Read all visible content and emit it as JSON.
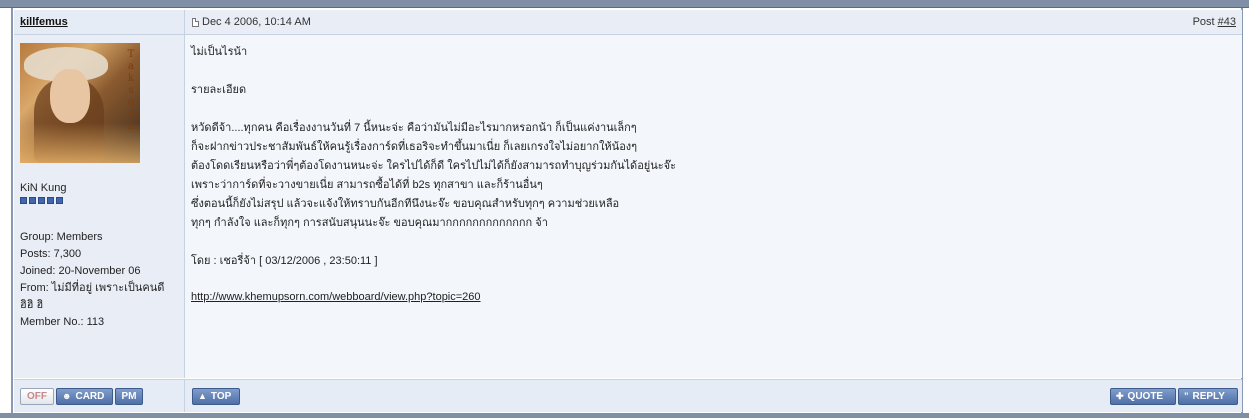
{
  "post": {
    "author": "killfemus",
    "date": "Dec 4 2006, 10:14 AM",
    "post_label": "Post ",
    "post_number": "#43"
  },
  "author_panel": {
    "avatar_letters": [
      "T",
      "a",
      "k",
      "s",
      "o",
      "r",
      "n"
    ],
    "title": "KiN Kung",
    "pip_count": 5,
    "group": "Group: Members",
    "posts": "Posts: 7,300",
    "joined": "Joined: 20-November 06",
    "from": "From: ไม่มีที่อยู่ เพราะเป็นคนดี ฮิฮิ ฮิ",
    "member_no": "Member No.: 113"
  },
  "body": {
    "lines": [
      "ไม่เป็นไรน้า",
      "",
      "รายละเอียด",
      "",
      "หวัดดีจ้า....ทุกคน คือเรื่องงานวันที่ 7 นี้หนะจ่ะ คือว่ามันไม่มีอะไรมากหรอกน้า ก็เป็นแค่งานเล็กๆ",
      "ก็จะฝากข่าวประชาสัมพันธ์ให้คนรู้เรื่องการ์ดที่เธอริจะทำขึ้นมาเนี่ย ก็เลยเกรงใจไม่อยากให้น้องๆ",
      "ต้องโดดเรียนหรือว่าพี่ๆต้องโดงานหนะจ่ะ ใครไปได้ก็ดี ใครไปไม่ได้ก็ยังสามารถทำบุญร่วมกันได้อยู่นะจ๊ะ",
      "เพราะว่าการ์ดที่จะวางขายเนี่ย สามารถซื้อได้ที่ b2s ทุกสาขา และก็ร้านอื่นๆ",
      "ซึ่งตอนนี้ก็ยังไม่สรุป แล้วจะแจ้งให้ทราบกันอีกทีนึงนะจ๊ะ ขอบคุณสำหรับทุกๆ ความช่วยเหลือ",
      "ทุกๆ กำลังใจ และก็ทุกๆ การสนับสนุนนะจ๊ะ ขอบคุณมากกกกกกกกกกกกก จ้า",
      "",
      "โดย : เชอรี่จ้า [ 03/12/2006 , 23:50:11 ]"
    ],
    "link": "http://www.khemupsorn.com/webboard/view.php?topic=260"
  },
  "footer": {
    "off_label": "OFF",
    "card_label": "CARD",
    "pm_label": "PM",
    "top_label": "TOP",
    "quote_label": "QUOTE",
    "reply_label": "REPLY"
  },
  "icons": {
    "post_marker": "document-icon",
    "card": "user-icon",
    "top": "arrow-up-icon",
    "quote": "plus-icon",
    "reply": "quote-icon"
  },
  "colors": {
    "header_bg": "#e9eef6",
    "body_bg": "#f3f6fb",
    "button_blue": "#4f6fa6",
    "frame": "#7f8fa6"
  }
}
